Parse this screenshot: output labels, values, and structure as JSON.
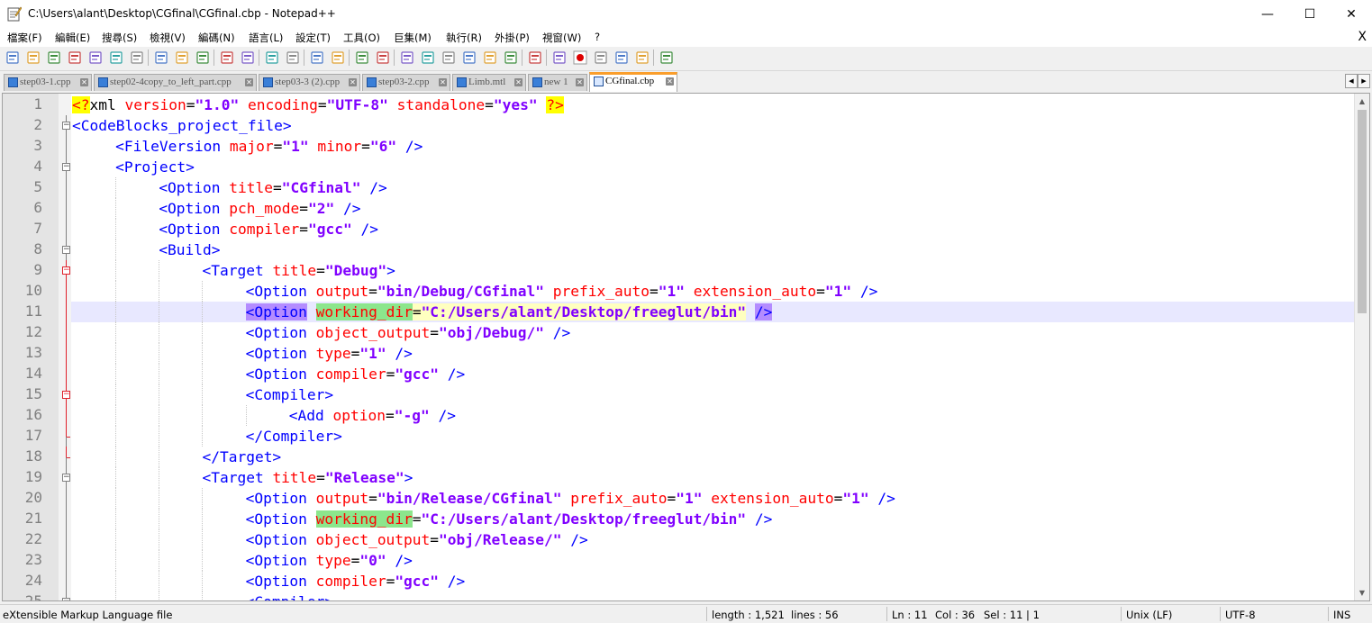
{
  "window": {
    "title": "C:\\Users\\alant\\Desktop\\CGfinal\\CGfinal.cbp - Notepad++",
    "minimize": "—",
    "maximize": "☐",
    "close": "✕"
  },
  "menu": {
    "items": [
      "檔案(F)",
      "編輯(E)",
      "搜尋(S)",
      "檢視(V)",
      "編碼(N)",
      "語言(L)",
      "設定(T)",
      "工具(O)",
      "巨集(M)",
      "執行(R)",
      "外掛(P)",
      "視窗(W)",
      "?"
    ],
    "close": "X"
  },
  "toolbar": {
    "icons": [
      "new-file-icon",
      "open-file-icon",
      "save-icon",
      "save-all-icon",
      "close-icon",
      "close-all-icon",
      "print-icon",
      "cut-icon",
      "copy-icon",
      "paste-icon",
      "undo-icon",
      "redo-icon",
      "find-icon",
      "replace-icon",
      "zoom-in-icon",
      "zoom-out-icon",
      "sync-vertical-icon",
      "sync-horizontal-icon",
      "word-wrap-icon",
      "show-all-chars-icon",
      "indent-guide-icon",
      "udl-icon",
      "doc-map-icon",
      "function-list-icon",
      "folder-workspace-icon",
      "monitoring-icon",
      "record-macro-icon",
      "stop-macro-icon",
      "play-macro-icon",
      "run-macro-multiple-icon",
      "save-macro-icon",
      "spell-check-icon"
    ],
    "spell_label": "ABC"
  },
  "tabs": [
    {
      "label": "step03-1.cpp",
      "active": false
    },
    {
      "label": "step02-4copy_to_left_part.cpp",
      "active": false
    },
    {
      "label": "step03-3 (2).cpp",
      "active": false
    },
    {
      "label": "step03-2.cpp",
      "active": false
    },
    {
      "label": "Limb.mtl",
      "active": false
    },
    {
      "label": "new 1",
      "active": false
    },
    {
      "label": "CGfinal.cbp",
      "active": true
    }
  ],
  "tab_scroll": {
    "left": "◀",
    "right": "▶"
  },
  "editor": {
    "colors": {
      "tag": "#0000ff",
      "attribute": "#ff0000",
      "value": "#8000ff",
      "current_line": "#e8e8ff",
      "match_highlight": "#8ce68c",
      "brace_highlight": "#b48cff",
      "selection_highlight": "#ffffc0"
    },
    "current_line_number": 11,
    "lines": [
      {
        "n": "1",
        "indent": 0,
        "fold": "none",
        "segs": [
          [
            "pi",
            "<?"
          ],
          [
            "plain",
            "xml "
          ],
          [
            "attr",
            "version"
          ],
          [
            "plain",
            "="
          ],
          [
            "val",
            "\"1.0\""
          ],
          [
            "plain",
            " "
          ],
          [
            "attr",
            "encoding"
          ],
          [
            "plain",
            "="
          ],
          [
            "val",
            "\"UTF-8\""
          ],
          [
            "plain",
            " "
          ],
          [
            "attr",
            "standalone"
          ],
          [
            "plain",
            "="
          ],
          [
            "val",
            "\"yes\""
          ],
          [
            "plain",
            " "
          ],
          [
            "pi",
            "?>"
          ]
        ]
      },
      {
        "n": "2",
        "indent": 0,
        "fold": "box",
        "segs": [
          [
            "tag",
            "<CodeBlocks_project_file>"
          ]
        ]
      },
      {
        "n": "3",
        "indent": 4,
        "fold": "line",
        "segs": [
          [
            "tag",
            "<FileVersion "
          ],
          [
            "attr",
            "major"
          ],
          [
            "plain",
            "="
          ],
          [
            "val",
            "\"1\""
          ],
          [
            "plain",
            " "
          ],
          [
            "attr",
            "minor"
          ],
          [
            "plain",
            "="
          ],
          [
            "val",
            "\"6\""
          ],
          [
            "plain",
            " "
          ],
          [
            "tag",
            "/>"
          ]
        ]
      },
      {
        "n": "4",
        "indent": 4,
        "fold": "box",
        "segs": [
          [
            "tag",
            "<Project>"
          ]
        ]
      },
      {
        "n": "5",
        "indent": 8,
        "fold": "line",
        "segs": [
          [
            "tag",
            "<Option "
          ],
          [
            "attr",
            "title"
          ],
          [
            "plain",
            "="
          ],
          [
            "val",
            "\"CGfinal\""
          ],
          [
            "plain",
            " "
          ],
          [
            "tag",
            "/>"
          ]
        ]
      },
      {
        "n": "6",
        "indent": 8,
        "fold": "line",
        "segs": [
          [
            "tag",
            "<Option "
          ],
          [
            "attr",
            "pch_mode"
          ],
          [
            "plain",
            "="
          ],
          [
            "val",
            "\"2\""
          ],
          [
            "plain",
            " "
          ],
          [
            "tag",
            "/>"
          ]
        ]
      },
      {
        "n": "7",
        "indent": 8,
        "fold": "line",
        "segs": [
          [
            "tag",
            "<Option "
          ],
          [
            "attr",
            "compiler"
          ],
          [
            "plain",
            "="
          ],
          [
            "val",
            "\"gcc\""
          ],
          [
            "plain",
            " "
          ],
          [
            "tag",
            "/>"
          ]
        ]
      },
      {
        "n": "8",
        "indent": 8,
        "fold": "box",
        "segs": [
          [
            "tag",
            "<Build>"
          ]
        ]
      },
      {
        "n": "9",
        "indent": 12,
        "fold": "boxred",
        "segs": [
          [
            "tag",
            "<Target "
          ],
          [
            "attr",
            "title"
          ],
          [
            "plain",
            "="
          ],
          [
            "val",
            "\"Debug\""
          ],
          [
            "tag",
            ">"
          ]
        ]
      },
      {
        "n": "10",
        "indent": 16,
        "fold": "linered",
        "segs": [
          [
            "tag",
            "<Option "
          ],
          [
            "attr",
            "output"
          ],
          [
            "plain",
            "="
          ],
          [
            "val",
            "\"bin/Debug/CGfinal\""
          ],
          [
            "plain",
            " "
          ],
          [
            "attr",
            "prefix_auto"
          ],
          [
            "plain",
            "="
          ],
          [
            "val",
            "\"1\""
          ],
          [
            "plain",
            " "
          ],
          [
            "attr",
            "extension_auto"
          ],
          [
            "plain",
            "="
          ],
          [
            "val",
            "\"1\""
          ],
          [
            "plain",
            " "
          ],
          [
            "tag",
            "/>"
          ]
        ]
      },
      {
        "n": "11",
        "indent": 16,
        "fold": "linered",
        "segs": [
          [
            "tag hl-purple",
            "<Option"
          ],
          [
            "plain",
            " "
          ],
          [
            "attr hl-green",
            "working_dir"
          ],
          [
            "plain hl-yellow",
            "="
          ],
          [
            "val hl-yellow",
            "\"C:/Users/alant/Desktop/freeglut/bin\""
          ],
          [
            "plain",
            " "
          ],
          [
            "tag hl-purple",
            "/>"
          ]
        ]
      },
      {
        "n": "12",
        "indent": 16,
        "fold": "linered",
        "segs": [
          [
            "tag",
            "<Option "
          ],
          [
            "attr",
            "object_output"
          ],
          [
            "plain",
            "="
          ],
          [
            "val",
            "\"obj/Debug/\""
          ],
          [
            "plain",
            " "
          ],
          [
            "tag",
            "/>"
          ]
        ]
      },
      {
        "n": "13",
        "indent": 16,
        "fold": "linered",
        "segs": [
          [
            "tag",
            "<Option "
          ],
          [
            "attr",
            "type"
          ],
          [
            "plain",
            "="
          ],
          [
            "val",
            "\"1\""
          ],
          [
            "plain",
            " "
          ],
          [
            "tag",
            "/>"
          ]
        ]
      },
      {
        "n": "14",
        "indent": 16,
        "fold": "linered",
        "segs": [
          [
            "tag",
            "<Option "
          ],
          [
            "attr",
            "compiler"
          ],
          [
            "plain",
            "="
          ],
          [
            "val",
            "\"gcc\""
          ],
          [
            "plain",
            " "
          ],
          [
            "tag",
            "/>"
          ]
        ]
      },
      {
        "n": "15",
        "indent": 16,
        "fold": "boxred",
        "segs": [
          [
            "tag",
            "<Compiler>"
          ]
        ]
      },
      {
        "n": "16",
        "indent": 20,
        "fold": "linered",
        "segs": [
          [
            "tag",
            "<Add "
          ],
          [
            "attr",
            "option"
          ],
          [
            "plain",
            "="
          ],
          [
            "val",
            "\"-g\""
          ],
          [
            "plain",
            " "
          ],
          [
            "tag",
            "/>"
          ]
        ]
      },
      {
        "n": "17",
        "indent": 16,
        "fold": "endred",
        "segs": [
          [
            "tag",
            "</Compiler>"
          ]
        ]
      },
      {
        "n": "18",
        "indent": 12,
        "fold": "endred",
        "segs": [
          [
            "tag",
            "</Target>"
          ]
        ]
      },
      {
        "n": "19",
        "indent": 12,
        "fold": "box",
        "segs": [
          [
            "tag",
            "<Target "
          ],
          [
            "attr",
            "title"
          ],
          [
            "plain",
            "="
          ],
          [
            "val",
            "\"Release\""
          ],
          [
            "tag",
            ">"
          ]
        ]
      },
      {
        "n": "20",
        "indent": 16,
        "fold": "line",
        "segs": [
          [
            "tag",
            "<Option "
          ],
          [
            "attr",
            "output"
          ],
          [
            "plain",
            "="
          ],
          [
            "val",
            "\"bin/Release/CGfinal\""
          ],
          [
            "plain",
            " "
          ],
          [
            "attr",
            "prefix_auto"
          ],
          [
            "plain",
            "="
          ],
          [
            "val",
            "\"1\""
          ],
          [
            "plain",
            " "
          ],
          [
            "attr",
            "extension_auto"
          ],
          [
            "plain",
            "="
          ],
          [
            "val",
            "\"1\""
          ],
          [
            "plain",
            " "
          ],
          [
            "tag",
            "/>"
          ]
        ]
      },
      {
        "n": "21",
        "indent": 16,
        "fold": "line",
        "segs": [
          [
            "tag",
            "<Option "
          ],
          [
            "attr hl-green",
            "working_dir"
          ],
          [
            "plain",
            "="
          ],
          [
            "val",
            "\"C:/Users/alant/Desktop/freeglut/bin\""
          ],
          [
            "plain",
            " "
          ],
          [
            "tag",
            "/>"
          ]
        ]
      },
      {
        "n": "22",
        "indent": 16,
        "fold": "line",
        "segs": [
          [
            "tag",
            "<Option "
          ],
          [
            "attr",
            "object_output"
          ],
          [
            "plain",
            "="
          ],
          [
            "val",
            "\"obj/Release/\""
          ],
          [
            "plain",
            " "
          ],
          [
            "tag",
            "/>"
          ]
        ]
      },
      {
        "n": "23",
        "indent": 16,
        "fold": "line",
        "segs": [
          [
            "tag",
            "<Option "
          ],
          [
            "attr",
            "type"
          ],
          [
            "plain",
            "="
          ],
          [
            "val",
            "\"0\""
          ],
          [
            "plain",
            " "
          ],
          [
            "tag",
            "/>"
          ]
        ]
      },
      {
        "n": "24",
        "indent": 16,
        "fold": "line",
        "segs": [
          [
            "tag",
            "<Option "
          ],
          [
            "attr",
            "compiler"
          ],
          [
            "plain",
            "="
          ],
          [
            "val",
            "\"gcc\""
          ],
          [
            "plain",
            " "
          ],
          [
            "tag",
            "/>"
          ]
        ]
      },
      {
        "n": "25",
        "indent": 16,
        "fold": "box",
        "segs": [
          [
            "tag",
            "<Compiler>"
          ]
        ]
      }
    ]
  },
  "status": {
    "file_type": "eXtensible Markup Language file",
    "length": "length : 1,521",
    "lines": "lines : 56",
    "ln": "Ln : 11",
    "col": "Col : 36",
    "sel": "Sel : 11 | 1",
    "eol": "Unix (LF)",
    "encoding": "UTF-8",
    "mode": "INS"
  }
}
